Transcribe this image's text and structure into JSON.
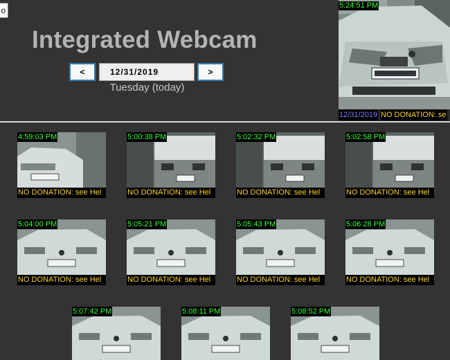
{
  "page": {
    "title": "Integrated Webcam",
    "corner_button_label": "o"
  },
  "date_nav": {
    "prev_label": "<",
    "date_value": "12/31/2019",
    "next_label": ">",
    "day_label": "Tuesday (today)"
  },
  "latest": {
    "time": "5:24:51 PM",
    "date": "12/31/2019",
    "donation": "NO DONATION: se"
  },
  "thumbnails": [
    {
      "time": "4:59:03 PM",
      "donation": "NO DONATION: see Hel",
      "scene": "car-front"
    },
    {
      "time": "5:00:38 PM",
      "donation": "NO DONATION: see Hel",
      "scene": "truck"
    },
    {
      "time": "5:02:32 PM",
      "donation": "NO DONATION: see Hel",
      "scene": "truck"
    },
    {
      "time": "5:02:58 PM",
      "donation": "NO DONATION: see Hel",
      "scene": "truck"
    },
    {
      "time": "5:04:00 PM",
      "donation": "NO DONATION: see Hel",
      "scene": "car-front"
    },
    {
      "time": "5:05:21 PM",
      "donation": "NO DONATION: see Hel",
      "scene": "car-front"
    },
    {
      "time": "5:05:43 PM",
      "donation": "NO DONATION: see Hel",
      "scene": "car-front"
    },
    {
      "time": "5:06:28 PM",
      "donation": "NO DONATION: see Hel",
      "scene": "car-front"
    },
    {
      "time": "5:07:42 PM",
      "donation": "",
      "scene": "car-front"
    },
    {
      "time": "5:08:11 PM",
      "donation": "",
      "scene": "car-front"
    },
    {
      "time": "5:08:52 PM",
      "donation": "",
      "scene": "car-front"
    }
  ],
  "colors": {
    "background": "#333333",
    "title": "#b4b4b4",
    "timestamp": "#39ff39",
    "donation": "#ffd42a",
    "date_stamp": "#7b7bff",
    "button_border": "#2f7fbf"
  }
}
